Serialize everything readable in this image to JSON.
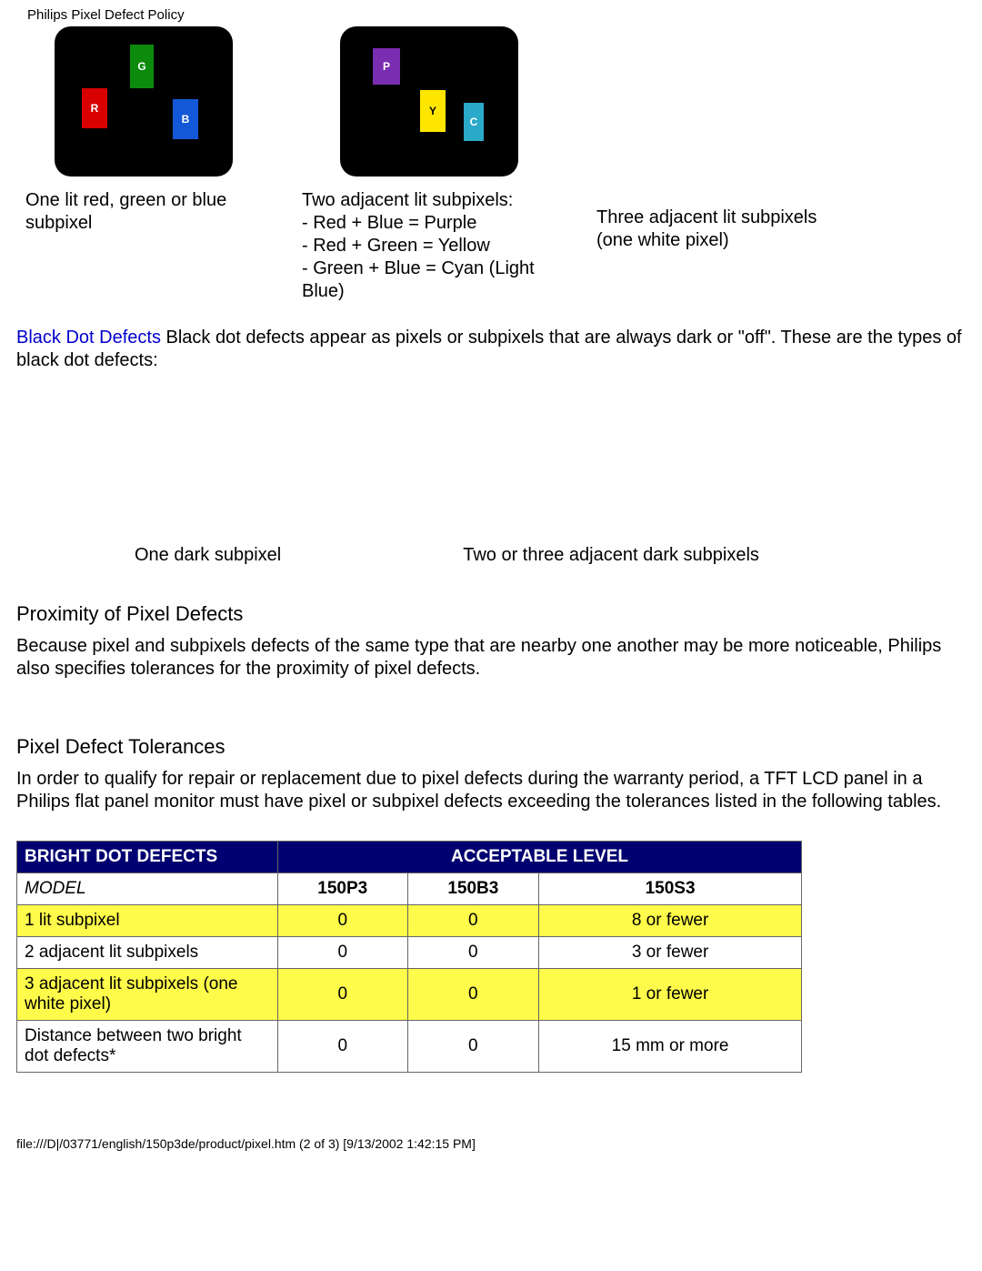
{
  "page_title": "Philips Pixel Defect Policy",
  "diagrams": {
    "panel1_chips": {
      "R": "R",
      "G": "G",
      "B": "B"
    },
    "panel2_chips": {
      "P": "P",
      "Y": "Y",
      "C": "C"
    },
    "caption1": "One lit red, green or blue subpixel",
    "caption2_line1": "Two adjacent lit subpixels:",
    "caption2_line2": "- Red + Blue = Purple",
    "caption2_line3": "- Red + Green = Yellow",
    "caption2_line4": "- Green + Blue = Cyan (Light Blue)",
    "caption3": "Three adjacent lit subpixels (one white pixel)"
  },
  "black_dots": {
    "term": "Black Dot Defects",
    "text": " Black dot defects appear as pixels or subpixels that are always dark or \"off\". These are the types of black dot defects:",
    "cap1": "One dark subpixel",
    "cap2": "Two or three adjacent dark subpixels"
  },
  "proximity": {
    "heading": "Proximity of Pixel Defects",
    "text": "Because pixel and subpixels defects of the same type that are nearby one another may be more noticeable, Philips also specifies tolerances for the proximity of pixel defects."
  },
  "tolerances": {
    "heading": "Pixel Defect Tolerances",
    "text": "In order to qualify for repair or replacement due to pixel defects during the warranty period, a TFT LCD panel in a Philips flat panel monitor must have pixel or subpixel defects exceeding the tolerances listed in the following tables."
  },
  "table": {
    "header_left": "BRIGHT DOT DEFECTS",
    "header_right": "ACCEPTABLE LEVEL",
    "model_label": "MODEL",
    "models": [
      "150P3",
      "150B3",
      "150S3"
    ],
    "rows": [
      {
        "label": "1 lit subpixel",
        "vals": [
          "0",
          "0",
          "8 or fewer"
        ],
        "yellow": true
      },
      {
        "label": "2 adjacent lit subpixels",
        "vals": [
          "0",
          "0",
          "3 or fewer"
        ],
        "yellow": false
      },
      {
        "label": "3 adjacent lit subpixels (one white pixel)",
        "vals": [
          "0",
          "0",
          "1 or fewer"
        ],
        "yellow": true
      },
      {
        "label": "Distance between two bright dot defects*",
        "vals": [
          "0",
          "0",
          "15 mm or more"
        ],
        "yellow": false
      }
    ]
  },
  "footer": "file:///D|/03771/english/150p3de/product/pixel.htm (2 of 3) [9/13/2002 1:42:15 PM]"
}
